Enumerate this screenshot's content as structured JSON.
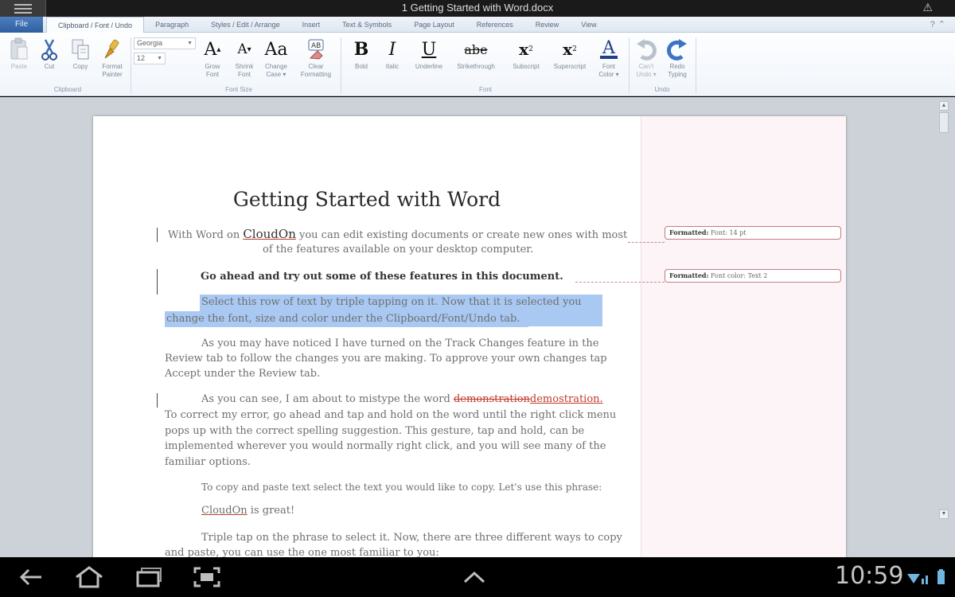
{
  "window": {
    "title": "1 Getting Started with Word.docx"
  },
  "tabs": {
    "file": "File",
    "items": [
      "Clipboard / Font / Undo",
      "Paragraph",
      "Styles / Edit / Arrange",
      "Insert",
      "Text & Symbols",
      "Page Layout",
      "References",
      "Review",
      "View"
    ]
  },
  "ribbon": {
    "font_name": "Georgia",
    "font_size": "12",
    "clipboard": {
      "paste": "Paste",
      "cut": "Cut",
      "copy": "Copy",
      "format_painter_1": "Format",
      "format_painter_2": "Painter",
      "group": "Clipboard"
    },
    "font_size_group": {
      "grow_1": "Grow",
      "grow_2": "Font",
      "shrink_1": "Shrink",
      "shrink_2": "Font",
      "change_1": "Change",
      "change_2": "Case ▾",
      "clear_1": "Clear",
      "clear_2": "Formatting",
      "group": "Font Size"
    },
    "font": {
      "bold": "Bold",
      "italic": "Italic",
      "underline": "Underline",
      "strike": "Strikethrough",
      "subscript": "Subscript",
      "superscript": "Superscript",
      "color_1": "Font",
      "color_2": "Color ▾",
      "group": "Font"
    },
    "undo": {
      "undo_1": "Can't",
      "undo_2": "Undo ▾",
      "redo_1": "Redo",
      "redo_2": "Typing",
      "group": "Undo"
    }
  },
  "document": {
    "heading": "Getting Started with Word",
    "p1_a": "With Word on ",
    "p1_brand": "CloudOn",
    "p1_b": " you can edit existing documents or create new ones with most",
    "p1_c": "of the features available on your desktop computer.",
    "p2": "Go ahead and try out some of these features in this document.",
    "p3_a": "Select this row of text by triple tapping on it.  Now that it is selected you can",
    "p3_b": "change the font, size and color  under the Clipboard/Font/Undo  tab.",
    "p4_a": "As you may have noticed I have turned on the Track Changes feature in the",
    "p4_b": "Review tab to follow  the changes you are making.  To approve your own changes tap",
    "p4_c": "Accept under the Review tab.",
    "p5_a": "As you can see, I am about to mistype the word ",
    "p5_del": "demonstration",
    "p5_ins": "demostration.",
    "p5_b": "To correct my error, go ahead and tap and hold  on the word  until the right click menu",
    "p5_c": "pops up with the correct spelling suggestion.  This gesture, tap and hold, can be",
    "p5_d": "implemented wherever you would normally right click, and you will  see many of the",
    "p5_e": "familiar  options.",
    "p6": "To copy and paste text select the text you would like to copy. Let's use this phrase:",
    "p7_brand": "CloudOn",
    "p7_rest": " is great!",
    "p8_a": "Triple tap on the phrase to select it. Now, there are three different ways to copy",
    "p8_b": "and paste, you can use the one most familiar to you:"
  },
  "comments": [
    {
      "label": "Formatted:",
      "text": " Font: 14 pt"
    },
    {
      "label": "Formatted:",
      "text": " Font color: Text 2"
    }
  ],
  "system": {
    "clock": "10:59"
  },
  "colors": {
    "file_tab": "#2f5f9f",
    "highlight": "#a9c9f2",
    "revision": "#c0392b"
  }
}
